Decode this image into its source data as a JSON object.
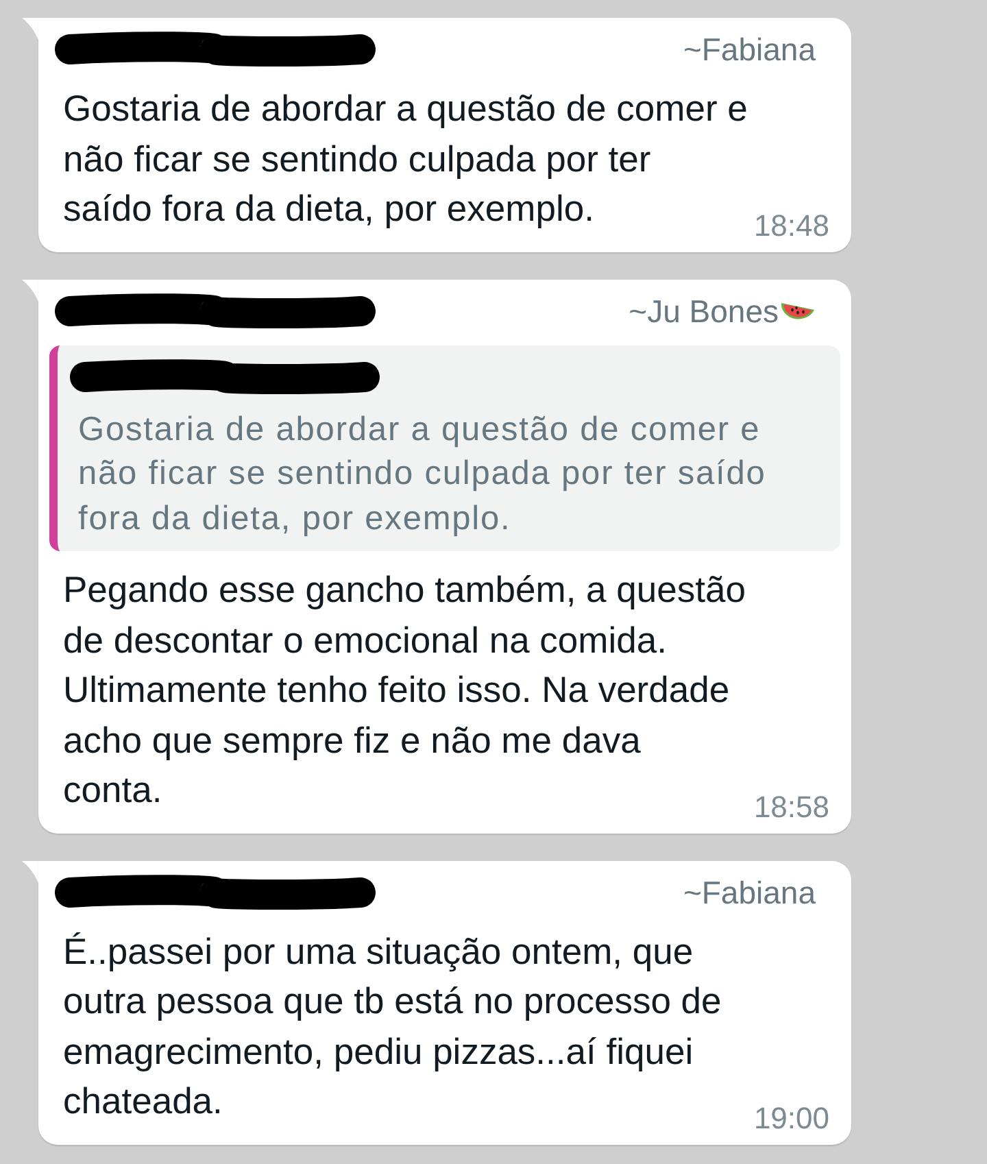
{
  "messages": [
    {
      "sender_redacted": true,
      "author": "~Fabiana",
      "author_emoji": false,
      "text": "Gostaria de abordar a questão de comer e\nnão ficar se sentindo culpada por ter\nsaído fora da dieta, por exemplo.",
      "time": "18:48"
    },
    {
      "sender_redacted": true,
      "author": "~Ju Bones",
      "author_emoji": true,
      "quote": {
        "sender_redacted": true,
        "text": "Gostaria de abordar a questão de comer e\nnão ficar se sentindo culpada por ter saído\nfora da dieta, por exemplo."
      },
      "text": "Pegando esse gancho também, a questão\nde descontar o emocional na comida.\nUltimamente tenho feito isso. Na verdade\nacho que sempre fiz e não me dava\nconta.",
      "time": "18:58"
    },
    {
      "sender_redacted": true,
      "author": "~Fabiana",
      "author_emoji": false,
      "text": "É..passei por uma situação ontem, que\noutra pessoa que tb está no processo de\nemagrecimento, pediu pizzas...aí fiquei\nchateada.",
      "time": "19:00"
    }
  ]
}
